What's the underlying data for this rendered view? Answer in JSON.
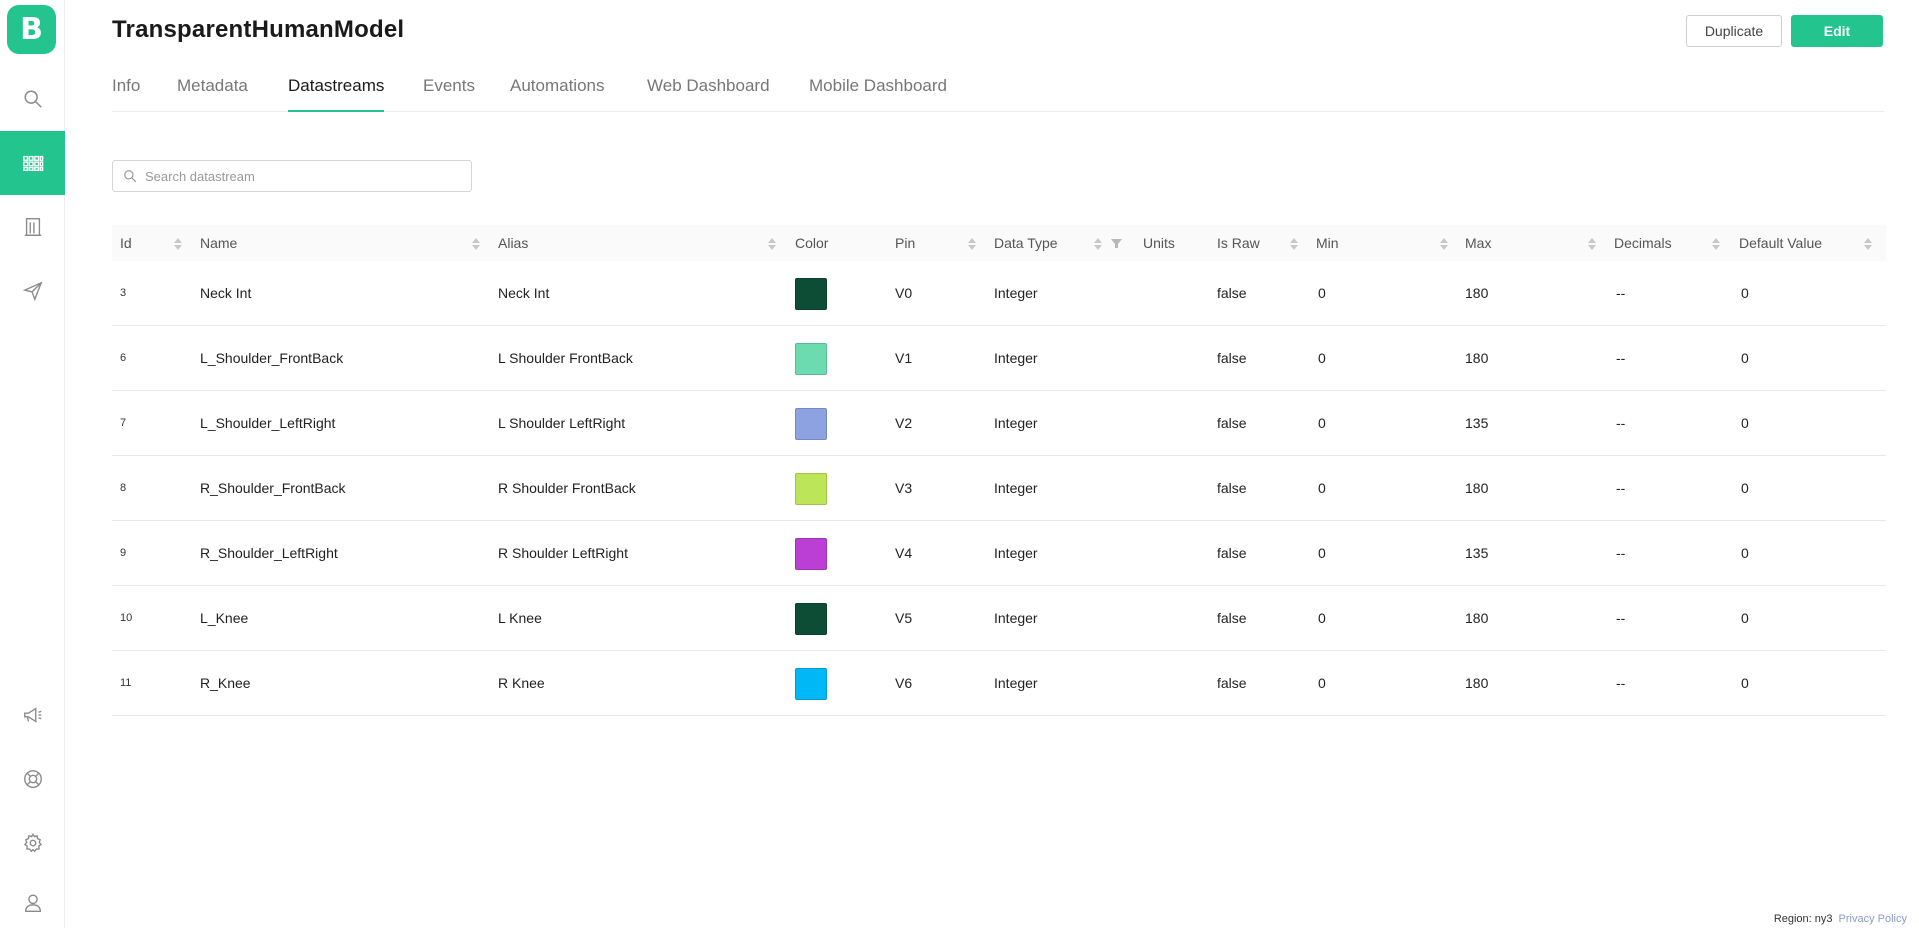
{
  "app": {
    "logo_letter": "B"
  },
  "sidebar": {
    "items": [
      {
        "name": "search",
        "icon": "search-icon"
      },
      {
        "name": "devices",
        "icon": "grid-icon",
        "active": true
      },
      {
        "name": "organizations",
        "icon": "building-icon"
      },
      {
        "name": "messages",
        "icon": "send-icon"
      },
      {
        "name": "announcements",
        "icon": "megaphone-icon"
      },
      {
        "name": "help",
        "icon": "lifebuoy-icon"
      },
      {
        "name": "settings",
        "icon": "gear-icon"
      },
      {
        "name": "profile",
        "icon": "user-icon"
      }
    ]
  },
  "header": {
    "title": "TransparentHumanModel",
    "duplicate_label": "Duplicate",
    "edit_label": "Edit"
  },
  "tabs": [
    {
      "label": "Info"
    },
    {
      "label": "Metadata"
    },
    {
      "label": "Datastreams",
      "active": true
    },
    {
      "label": "Events"
    },
    {
      "label": "Automations"
    },
    {
      "label": "Web Dashboard"
    },
    {
      "label": "Mobile Dashboard"
    }
  ],
  "search": {
    "placeholder": "Search datastream",
    "value": ""
  },
  "table": {
    "columns": [
      "Id",
      "Name",
      "Alias",
      "Color",
      "Pin",
      "Data Type",
      "Units",
      "Is Raw",
      "Min",
      "Max",
      "Decimals",
      "Default Value"
    ],
    "rows": [
      {
        "id": "3",
        "name": "Neck Int",
        "alias": "Neck Int",
        "color": "#0d4d36",
        "pin": "V0",
        "data_type": "Integer",
        "units": "",
        "is_raw": "false",
        "min": "0",
        "max": "180",
        "decimals": "--",
        "default": "0"
      },
      {
        "id": "6",
        "name": "L_Shoulder_FrontBack",
        "alias": "L Shoulder FrontBack",
        "color": "#6cdcb0",
        "pin": "V1",
        "data_type": "Integer",
        "units": "",
        "is_raw": "false",
        "min": "0",
        "max": "180",
        "decimals": "--",
        "default": "0"
      },
      {
        "id": "7",
        "name": "L_Shoulder_LeftRight",
        "alias": "L Shoulder LeftRight",
        "color": "#8da2e0",
        "pin": "V2",
        "data_type": "Integer",
        "units": "",
        "is_raw": "false",
        "min": "0",
        "max": "135",
        "decimals": "--",
        "default": "0"
      },
      {
        "id": "8",
        "name": "R_Shoulder_FrontBack",
        "alias": "R Shoulder FrontBack",
        "color": "#bde55a",
        "pin": "V3",
        "data_type": "Integer",
        "units": "",
        "is_raw": "false",
        "min": "0",
        "max": "180",
        "decimals": "--",
        "default": "0"
      },
      {
        "id": "9",
        "name": "R_Shoulder_LeftRight",
        "alias": "R Shoulder LeftRight",
        "color": "#bb3fd4",
        "pin": "V4",
        "data_type": "Integer",
        "units": "",
        "is_raw": "false",
        "min": "0",
        "max": "135",
        "decimals": "--",
        "default": "0"
      },
      {
        "id": "10",
        "name": "L_Knee",
        "alias": "L Knee",
        "color": "#0d4d36",
        "pin": "V5",
        "data_type": "Integer",
        "units": "",
        "is_raw": "false",
        "min": "0",
        "max": "180",
        "decimals": "--",
        "default": "0"
      },
      {
        "id": "11",
        "name": "R_Knee",
        "alias": "R Knee",
        "color": "#00b8f5",
        "pin": "V6",
        "data_type": "Integer",
        "units": "",
        "is_raw": "false",
        "min": "0",
        "max": "180",
        "decimals": "--",
        "default": "0"
      }
    ]
  },
  "footer": {
    "region": "Region: ny3",
    "privacy": "Privacy Policy"
  },
  "colors": {
    "accent": "#23c48e",
    "icon": "#8a8a8a"
  }
}
